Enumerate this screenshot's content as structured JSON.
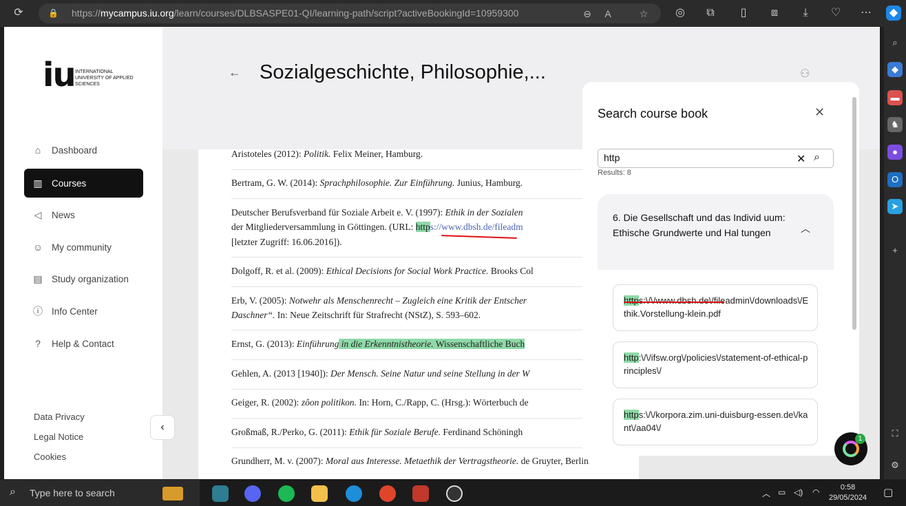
{
  "browser": {
    "url_prefix": "https://",
    "url_domain": "mycampus.iu.org",
    "url_path": "/learn/courses/DLBSASPE01-QI/learning-path/script?activeBookingId=10959300"
  },
  "sidebar": {
    "logo_text": "iu",
    "logo_tagline": "International University of Applied Sciences",
    "items": [
      {
        "label": "Dashboard",
        "icon": "home-icon"
      },
      {
        "label": "Courses",
        "icon": "books-icon"
      },
      {
        "label": "News",
        "icon": "megaphone-icon"
      },
      {
        "label": "My community",
        "icon": "people-icon"
      },
      {
        "label": "Study organization",
        "icon": "notebook-icon"
      },
      {
        "label": "Info Center",
        "icon": "info-icon"
      },
      {
        "label": "Help & Contact",
        "icon": "help-icon"
      }
    ],
    "footer": [
      "Data Privacy",
      "Legal Notice",
      "Cookies"
    ]
  },
  "page": {
    "title": "Sozialgeschichte, Philosophie,..."
  },
  "references": [
    {
      "a": "Aristoteles (2012): ",
      "b": "Politik.",
      "c": " Felix Meiner, Hamburg."
    },
    {
      "a": "Bertram, G. W. (2014): ",
      "b": "Sprachphilosophie. Zur Einführung.",
      "c": " Junius, Hamburg."
    },
    {
      "a": "Deutscher Berufsverband für Soziale Arbeit e. V. (1997): ",
      "b": "Ethik in der Sozialen",
      "line2a": "der Mitgliederversammlung in Göttingen. (URL: ",
      "line2hl": "http",
      "line2link": "s://www.dbsh.de/fileadm",
      "line3": "[letzter Zugriff: 16.06.2016])."
    },
    {
      "a": "Dolgoff, R. et al. (2009): ",
      "b": "Ethical Decisions for Social Work Practice.",
      "c": " Brooks Col"
    },
    {
      "a": "Erb, V. (2005): ",
      "b": "Notwehr als Menschenrecht – Zugleich eine Kritik der Entscher",
      "line2b": "Daschner“.",
      "line2c": " In: Neue Zeitschrift für Strafrecht (NStZ), S. 593–602."
    },
    {
      "a": "Ernst, G. (2013): ",
      "b": "Einführung",
      "hl": " in die Erkenntnistheorie.",
      "c": " Wissenschaftliche Buch"
    },
    {
      "a": "Gehlen, A. (2013 [1940]): ",
      "b": "Der Mensch. Seine Natur und seine Stellung in der W"
    },
    {
      "a": "Geiger, R. (2002): ",
      "b": "zôon politikon.",
      "c": " In: Horn, C./Rapp, C. (Hrsg.): Wörterbuch de"
    },
    {
      "a": "Großmaß, R./Perko, G. (2011): ",
      "b": "Ethik für Soziale Berufe.",
      "c": " Ferdinand Schöningh"
    },
    {
      "a": "Grundherr, M. v. (2007): ",
      "b": "Moral aus Interesse. Metaethik der Vertragstheorie.",
      "c": " de Gruyter, Berlin."
    }
  ],
  "search_panel": {
    "title": "Search course book",
    "query": "http",
    "results_label": "Results: 8",
    "section_title": "6. Die Gesellschaft und das Individ uum: Ethische Grundwerte und Hal tungen",
    "hits": [
      {
        "hl": "http",
        "rest": "s:\\/\\/www.dbsh.de\\/fileadmin\\/downloads\\/Ethik.Vorstellung-klein.pdf"
      },
      {
        "hl": "http",
        "rest": ":\\/\\/ifsw.org\\/policies\\/statement-of-ethical-principles\\/"
      },
      {
        "hl": "http",
        "rest": "s:\\/\\/korpora.zim.uni-duisburg-essen.de\\/kant\\/aa04\\/"
      }
    ],
    "ai_badge_count": "1"
  },
  "taskbar": {
    "search_placeholder": "Type here to search",
    "time": "0:58",
    "date": "29/05/2024"
  },
  "colors": {
    "highlight": "#8fd9a8",
    "active_nav": "#111111",
    "annotation_red": "#dd1111"
  }
}
